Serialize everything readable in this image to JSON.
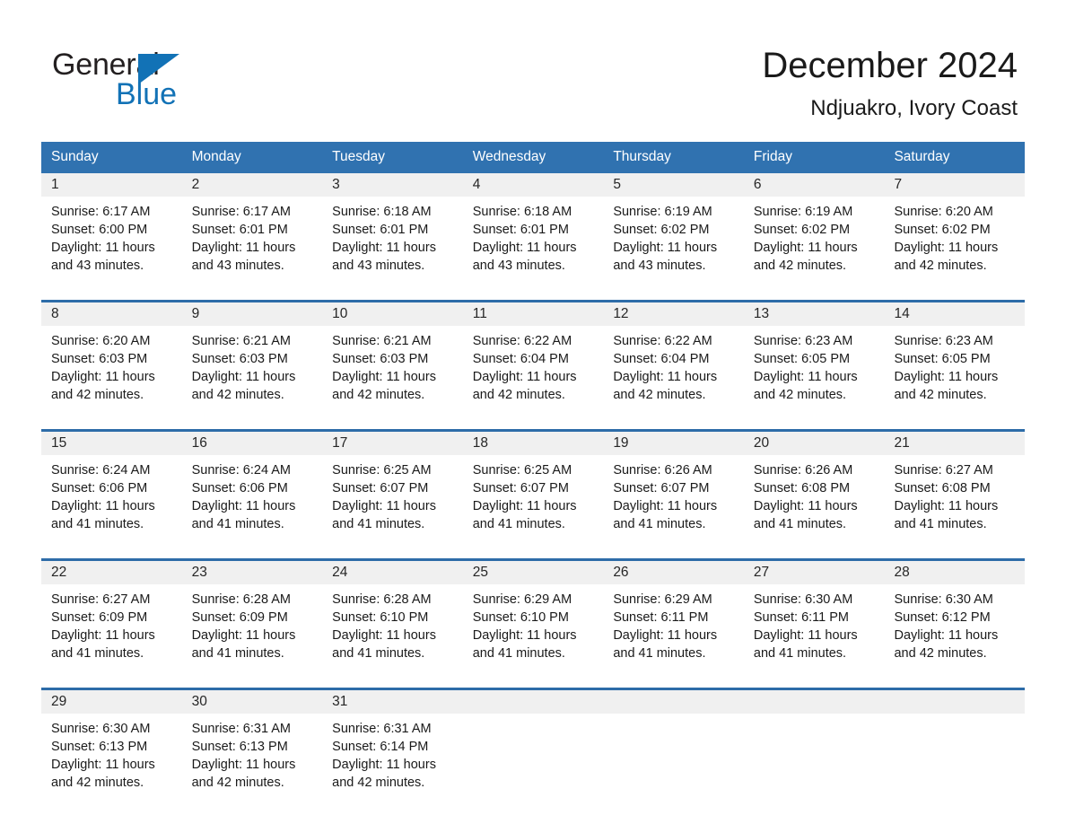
{
  "brand": {
    "name_part1": "General",
    "name_part2": "Blue",
    "accent_color": "#1272b6",
    "triangle_icon": "triangle-icon"
  },
  "header": {
    "title": "December 2024",
    "subtitle": "Ndjuakro, Ivory Coast"
  },
  "calendar": {
    "header_bg": "#3072b0",
    "header_text_color": "#ffffff",
    "row_divider_color": "#2d6ca8",
    "daynum_bg": "#f0f0f0",
    "day_names": [
      "Sunday",
      "Monday",
      "Tuesday",
      "Wednesday",
      "Thursday",
      "Friday",
      "Saturday"
    ],
    "weeks": [
      [
        {
          "day": "1",
          "sunrise": "Sunrise: 6:17 AM",
          "sunset": "Sunset: 6:00 PM",
          "daylight1": "Daylight: 11 hours",
          "daylight2": "and 43 minutes."
        },
        {
          "day": "2",
          "sunrise": "Sunrise: 6:17 AM",
          "sunset": "Sunset: 6:01 PM",
          "daylight1": "Daylight: 11 hours",
          "daylight2": "and 43 minutes."
        },
        {
          "day": "3",
          "sunrise": "Sunrise: 6:18 AM",
          "sunset": "Sunset: 6:01 PM",
          "daylight1": "Daylight: 11 hours",
          "daylight2": "and 43 minutes."
        },
        {
          "day": "4",
          "sunrise": "Sunrise: 6:18 AM",
          "sunset": "Sunset: 6:01 PM",
          "daylight1": "Daylight: 11 hours",
          "daylight2": "and 43 minutes."
        },
        {
          "day": "5",
          "sunrise": "Sunrise: 6:19 AM",
          "sunset": "Sunset: 6:02 PM",
          "daylight1": "Daylight: 11 hours",
          "daylight2": "and 43 minutes."
        },
        {
          "day": "6",
          "sunrise": "Sunrise: 6:19 AM",
          "sunset": "Sunset: 6:02 PM",
          "daylight1": "Daylight: 11 hours",
          "daylight2": "and 42 minutes."
        },
        {
          "day": "7",
          "sunrise": "Sunrise: 6:20 AM",
          "sunset": "Sunset: 6:02 PM",
          "daylight1": "Daylight: 11 hours",
          "daylight2": "and 42 minutes."
        }
      ],
      [
        {
          "day": "8",
          "sunrise": "Sunrise: 6:20 AM",
          "sunset": "Sunset: 6:03 PM",
          "daylight1": "Daylight: 11 hours",
          "daylight2": "and 42 minutes."
        },
        {
          "day": "9",
          "sunrise": "Sunrise: 6:21 AM",
          "sunset": "Sunset: 6:03 PM",
          "daylight1": "Daylight: 11 hours",
          "daylight2": "and 42 minutes."
        },
        {
          "day": "10",
          "sunrise": "Sunrise: 6:21 AM",
          "sunset": "Sunset: 6:03 PM",
          "daylight1": "Daylight: 11 hours",
          "daylight2": "and 42 minutes."
        },
        {
          "day": "11",
          "sunrise": "Sunrise: 6:22 AM",
          "sunset": "Sunset: 6:04 PM",
          "daylight1": "Daylight: 11 hours",
          "daylight2": "and 42 minutes."
        },
        {
          "day": "12",
          "sunrise": "Sunrise: 6:22 AM",
          "sunset": "Sunset: 6:04 PM",
          "daylight1": "Daylight: 11 hours",
          "daylight2": "and 42 minutes."
        },
        {
          "day": "13",
          "sunrise": "Sunrise: 6:23 AM",
          "sunset": "Sunset: 6:05 PM",
          "daylight1": "Daylight: 11 hours",
          "daylight2": "and 42 minutes."
        },
        {
          "day": "14",
          "sunrise": "Sunrise: 6:23 AM",
          "sunset": "Sunset: 6:05 PM",
          "daylight1": "Daylight: 11 hours",
          "daylight2": "and 42 minutes."
        }
      ],
      [
        {
          "day": "15",
          "sunrise": "Sunrise: 6:24 AM",
          "sunset": "Sunset: 6:06 PM",
          "daylight1": "Daylight: 11 hours",
          "daylight2": "and 41 minutes."
        },
        {
          "day": "16",
          "sunrise": "Sunrise: 6:24 AM",
          "sunset": "Sunset: 6:06 PM",
          "daylight1": "Daylight: 11 hours",
          "daylight2": "and 41 minutes."
        },
        {
          "day": "17",
          "sunrise": "Sunrise: 6:25 AM",
          "sunset": "Sunset: 6:07 PM",
          "daylight1": "Daylight: 11 hours",
          "daylight2": "and 41 minutes."
        },
        {
          "day": "18",
          "sunrise": "Sunrise: 6:25 AM",
          "sunset": "Sunset: 6:07 PM",
          "daylight1": "Daylight: 11 hours",
          "daylight2": "and 41 minutes."
        },
        {
          "day": "19",
          "sunrise": "Sunrise: 6:26 AM",
          "sunset": "Sunset: 6:07 PM",
          "daylight1": "Daylight: 11 hours",
          "daylight2": "and 41 minutes."
        },
        {
          "day": "20",
          "sunrise": "Sunrise: 6:26 AM",
          "sunset": "Sunset: 6:08 PM",
          "daylight1": "Daylight: 11 hours",
          "daylight2": "and 41 minutes."
        },
        {
          "day": "21",
          "sunrise": "Sunrise: 6:27 AM",
          "sunset": "Sunset: 6:08 PM",
          "daylight1": "Daylight: 11 hours",
          "daylight2": "and 41 minutes."
        }
      ],
      [
        {
          "day": "22",
          "sunrise": "Sunrise: 6:27 AM",
          "sunset": "Sunset: 6:09 PM",
          "daylight1": "Daylight: 11 hours",
          "daylight2": "and 41 minutes."
        },
        {
          "day": "23",
          "sunrise": "Sunrise: 6:28 AM",
          "sunset": "Sunset: 6:09 PM",
          "daylight1": "Daylight: 11 hours",
          "daylight2": "and 41 minutes."
        },
        {
          "day": "24",
          "sunrise": "Sunrise: 6:28 AM",
          "sunset": "Sunset: 6:10 PM",
          "daylight1": "Daylight: 11 hours",
          "daylight2": "and 41 minutes."
        },
        {
          "day": "25",
          "sunrise": "Sunrise: 6:29 AM",
          "sunset": "Sunset: 6:10 PM",
          "daylight1": "Daylight: 11 hours",
          "daylight2": "and 41 minutes."
        },
        {
          "day": "26",
          "sunrise": "Sunrise: 6:29 AM",
          "sunset": "Sunset: 6:11 PM",
          "daylight1": "Daylight: 11 hours",
          "daylight2": "and 41 minutes."
        },
        {
          "day": "27",
          "sunrise": "Sunrise: 6:30 AM",
          "sunset": "Sunset: 6:11 PM",
          "daylight1": "Daylight: 11 hours",
          "daylight2": "and 41 minutes."
        },
        {
          "day": "28",
          "sunrise": "Sunrise: 6:30 AM",
          "sunset": "Sunset: 6:12 PM",
          "daylight1": "Daylight: 11 hours",
          "daylight2": "and 42 minutes."
        }
      ],
      [
        {
          "day": "29",
          "sunrise": "Sunrise: 6:30 AM",
          "sunset": "Sunset: 6:13 PM",
          "daylight1": "Daylight: 11 hours",
          "daylight2": "and 42 minutes."
        },
        {
          "day": "30",
          "sunrise": "Sunrise: 6:31 AM",
          "sunset": "Sunset: 6:13 PM",
          "daylight1": "Daylight: 11 hours",
          "daylight2": "and 42 minutes."
        },
        {
          "day": "31",
          "sunrise": "Sunrise: 6:31 AM",
          "sunset": "Sunset: 6:14 PM",
          "daylight1": "Daylight: 11 hours",
          "daylight2": "and 42 minutes."
        },
        {
          "day": "",
          "sunrise": "",
          "sunset": "",
          "daylight1": "",
          "daylight2": ""
        },
        {
          "day": "",
          "sunrise": "",
          "sunset": "",
          "daylight1": "",
          "daylight2": ""
        },
        {
          "day": "",
          "sunrise": "",
          "sunset": "",
          "daylight1": "",
          "daylight2": ""
        },
        {
          "day": "",
          "sunrise": "",
          "sunset": "",
          "daylight1": "",
          "daylight2": ""
        }
      ]
    ]
  }
}
